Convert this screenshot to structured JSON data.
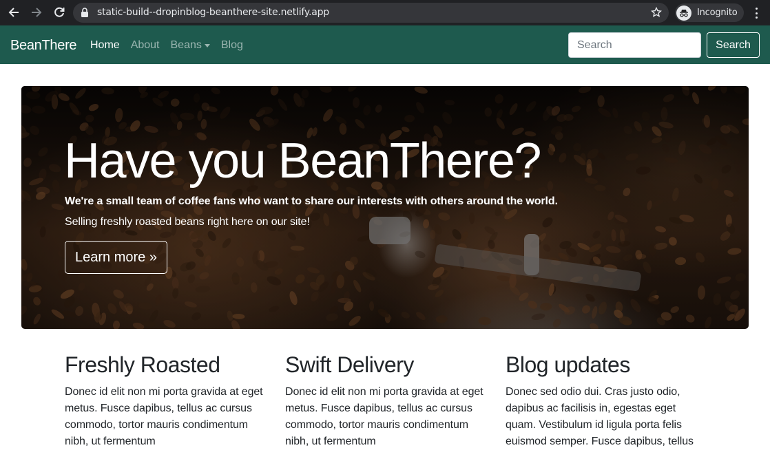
{
  "browser": {
    "url": "static-build--dropinblog-beanthere-site.netlify.app",
    "profile_label": "Incognito",
    "icons": [
      "back-arrow-icon",
      "forward-arrow-icon",
      "reload-icon",
      "lock-icon",
      "star-icon",
      "incognito-icon",
      "more-vert-icon"
    ]
  },
  "navbar": {
    "brand": "BeanThere",
    "links": [
      {
        "label": "Home",
        "active": true
      },
      {
        "label": "About",
        "active": false
      },
      {
        "label": "Beans",
        "active": false,
        "dropdown": true
      },
      {
        "label": "Blog",
        "active": false
      }
    ],
    "search_placeholder": "Search",
    "search_button": "Search",
    "background": "#1e5a4e"
  },
  "hero": {
    "title": "Have you BeanThere?",
    "lead": "We're a small team of coffee fans who want to share our interests with others around the world.",
    "sub": "Selling freshly roasted beans right here on our site!",
    "button": "Learn more »"
  },
  "features": [
    {
      "title": "Freshly Roasted",
      "text": "Donec id elit non mi porta gravida at eget metus. Fusce dapibus, tellus ac cursus commodo, tortor mauris condimentum nibh, ut fermentum"
    },
    {
      "title": "Swift Delivery",
      "text": "Donec id elit non mi porta gravida at eget metus. Fusce dapibus, tellus ac cursus commodo, tortor mauris condimentum nibh, ut fermentum"
    },
    {
      "title": "Blog updates",
      "text": "Donec sed odio dui. Cras justo odio, dapibus ac facilisis in, egestas eget quam. Vestibulum id ligula porta felis euismod semper. Fusce dapibus, tellus"
    }
  ]
}
